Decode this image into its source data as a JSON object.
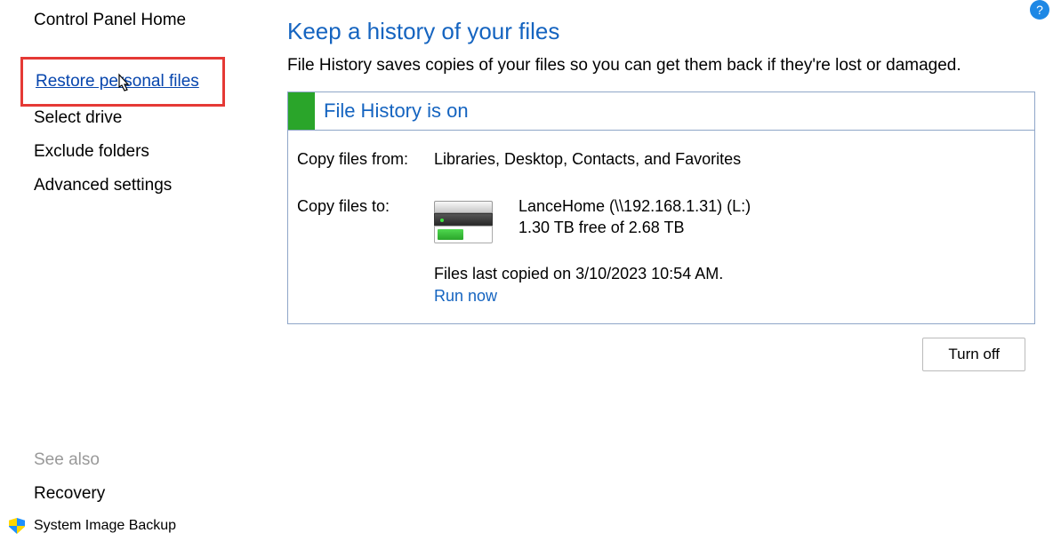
{
  "sidebar": {
    "home": "Control Panel Home",
    "restore": "Restore personal files",
    "select_drive": "Select drive",
    "exclude": "Exclude folders",
    "advanced": "Advanced settings",
    "see_also": "See also",
    "recovery": "Recovery",
    "system_image": "System Image Backup"
  },
  "main": {
    "title": "Keep a history of your files",
    "description": "File History saves copies of your files so you can get them back if they're lost or damaged.",
    "status_title": "File History is on",
    "copy_from_label": "Copy files from:",
    "copy_from_value": "Libraries, Desktop, Contacts, and Favorites",
    "copy_to_label": "Copy files to:",
    "drive_name": "LanceHome (\\\\192.168.1.31) (L:)",
    "drive_space": "1.30 TB free of 2.68 TB",
    "last_copied": "Files last copied on 3/10/2023 10:54 AM.",
    "run_now": "Run now",
    "turn_off": "Turn off"
  },
  "help": "?"
}
